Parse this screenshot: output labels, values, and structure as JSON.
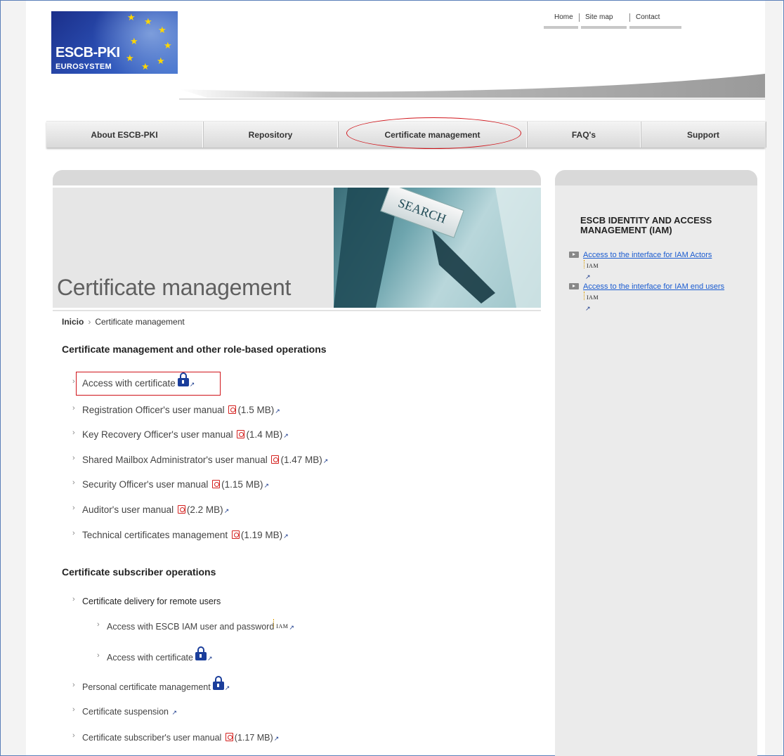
{
  "logo": {
    "line1": "ESCB-PKI",
    "line2": "EUROSYSTEM"
  },
  "top_links": {
    "home": "Home",
    "site_map": "Site map",
    "contact": "Contact"
  },
  "nav": {
    "items": [
      {
        "label": "About ESCB-PKI"
      },
      {
        "label": "Repository"
      },
      {
        "label": "Certificate management"
      },
      {
        "label": "FAQ's"
      },
      {
        "label": "Support"
      }
    ],
    "highlighted": "Certificate management"
  },
  "banner": {
    "title": "Certificate management",
    "image_text": "SEARCH"
  },
  "breadcrumb": {
    "home": "Inicio",
    "current": "Certificate management"
  },
  "section1": {
    "heading": "Certificate management and other role-based operations",
    "items": [
      {
        "label": "Access with certificate"
      },
      {
        "label": "Registration Officer's user manual",
        "size": "(1.5 MB)"
      },
      {
        "label": "Key Recovery Officer's user manual",
        "size": "(1.4 MB)"
      },
      {
        "label": "Shared Mailbox Administrator's user manual",
        "size": "(1.47 MB)"
      },
      {
        "label": "Security Officer's user manual",
        "size": "(1.15 MB)"
      },
      {
        "label": "Auditor's user manual",
        "size": "(2.2 MB)"
      },
      {
        "label": "Technical certificates management",
        "size": "(1.19 MB)"
      }
    ]
  },
  "section2": {
    "heading": "Certificate subscriber operations",
    "delivery": "Certificate delivery for remote users",
    "sub_items": [
      {
        "label": "Access with ESCB IAM user and password"
      },
      {
        "label": "Access with certificate"
      }
    ],
    "items": [
      {
        "label": "Personal certificate management"
      },
      {
        "label": "Certificate suspension"
      },
      {
        "label": "Certificate subscriber's user manual",
        "size": "(1.17 MB)"
      }
    ]
  },
  "sidebar": {
    "title": "ESCB IDENTITY AND ACCESS MANAGEMENT (IAM)",
    "links": [
      {
        "label": "Access to the interface for IAM Actors"
      },
      {
        "label": "Access to the interface for IAM end users"
      }
    ],
    "iam_badge": "IAM"
  },
  "colors": {
    "annotation_red": "#d0141a",
    "link_blue": "#1a5bd0",
    "lock_blue": "#1b3e9b"
  }
}
